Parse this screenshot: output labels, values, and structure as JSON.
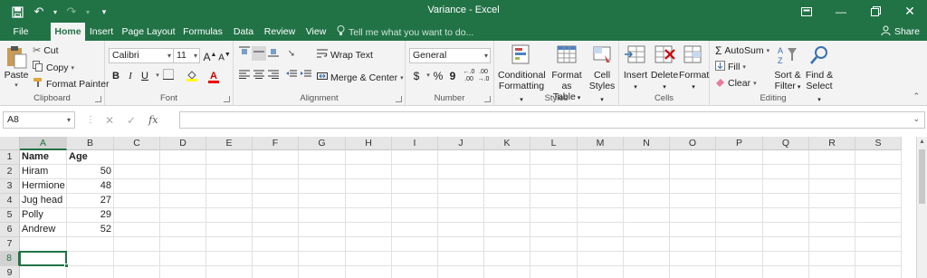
{
  "window": {
    "title": "Variance - Excel",
    "accent": "#217346",
    "quick_access": [
      "save-icon",
      "undo-icon",
      "redo-icon",
      "customize-icon"
    ],
    "controls": [
      "ribbon-display-icon",
      "minimize-icon",
      "restore-icon",
      "close-icon"
    ]
  },
  "tabs": [
    {
      "label": "File"
    },
    {
      "label": "Home"
    },
    {
      "label": "Insert"
    },
    {
      "label": "Page Layout"
    },
    {
      "label": "Formulas"
    },
    {
      "label": "Data"
    },
    {
      "label": "Review"
    },
    {
      "label": "View"
    }
  ],
  "active_tab": "Home",
  "tell_me": "Tell me what you want to do...",
  "share": "Share",
  "ribbon": {
    "clipboard": {
      "label": "Clipboard",
      "paste": "Paste",
      "cut": "Cut",
      "copy": "Copy",
      "format_painter": "Format Painter"
    },
    "font": {
      "label": "Font",
      "font_name": "Calibri",
      "font_size": "11",
      "bold": "B",
      "italic": "I",
      "underline": "U",
      "grow": "A",
      "shrink": "A",
      "font_color": "A"
    },
    "alignment": {
      "label": "Alignment",
      "wrap_text": "Wrap Text",
      "merge_center": "Merge & Center"
    },
    "number": {
      "label": "Number",
      "format": "General",
      "currency": "$",
      "percent": "%",
      "comma": "9"
    },
    "styles": {
      "label": "Styles",
      "conditional": "Conditional",
      "conditional2": "Formatting",
      "format_as": "Format as",
      "format_as2": "Table",
      "cell": "Cell",
      "cell2": "Styles"
    },
    "cells": {
      "label": "Cells",
      "insert": "Insert",
      "delete": "Delete",
      "format": "Format"
    },
    "editing": {
      "label": "Editing",
      "autosum": "AutoSum",
      "fill": "Fill",
      "clear": "Clear",
      "sort": "Sort &",
      "sort2": "Filter",
      "find": "Find &",
      "find2": "Select"
    }
  },
  "formula_bar": {
    "name_box": "A8",
    "fx": "fx",
    "value": ""
  },
  "grid": {
    "columns": [
      "A",
      "B",
      "C",
      "D",
      "E",
      "F",
      "G",
      "H",
      "I",
      "J",
      "K",
      "L",
      "M",
      "N",
      "O",
      "P",
      "Q",
      "R",
      "S"
    ],
    "rows": [
      "1",
      "2",
      "3",
      "4",
      "5",
      "6",
      "7",
      "8",
      "9"
    ],
    "cells": {
      "A1": "Name",
      "B1": "Age",
      "A2": "Hiram",
      "B2": "50",
      "A3": "Hermione",
      "B3": "48",
      "A4": "Jug head",
      "B4": "27",
      "A5": "Polly",
      "B5": "29",
      "A6": "Andrew",
      "B6": "52"
    },
    "active_cell": "A8"
  }
}
